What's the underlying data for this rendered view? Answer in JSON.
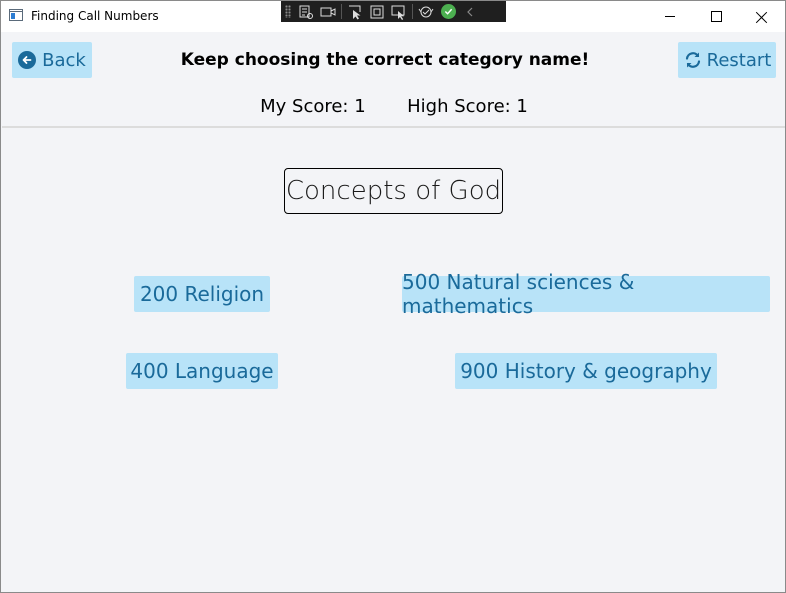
{
  "window": {
    "title": "Finding Call Numbers"
  },
  "header": {
    "back_label": "Back",
    "restart_label": "Restart",
    "instruction": "Keep choosing the correct category name!",
    "my_score_label": "My Score: 1",
    "high_score_label": "High Score: 1"
  },
  "main": {
    "prompt": "Concepts of God",
    "options": [
      {
        "label": "200 Religion"
      },
      {
        "label": "500 Natural sciences & mathematics"
      },
      {
        "label": "400 Language"
      },
      {
        "label": "900 History & geography"
      }
    ]
  },
  "colors": {
    "button_bg": "#b8e3f8",
    "button_text": "#1a6a9a",
    "page_bg": "#f3f4f7"
  },
  "icons": [
    "app-icon",
    "back-arrow-icon",
    "restart-icon",
    "minimize-icon",
    "maximize-icon",
    "close-icon"
  ]
}
